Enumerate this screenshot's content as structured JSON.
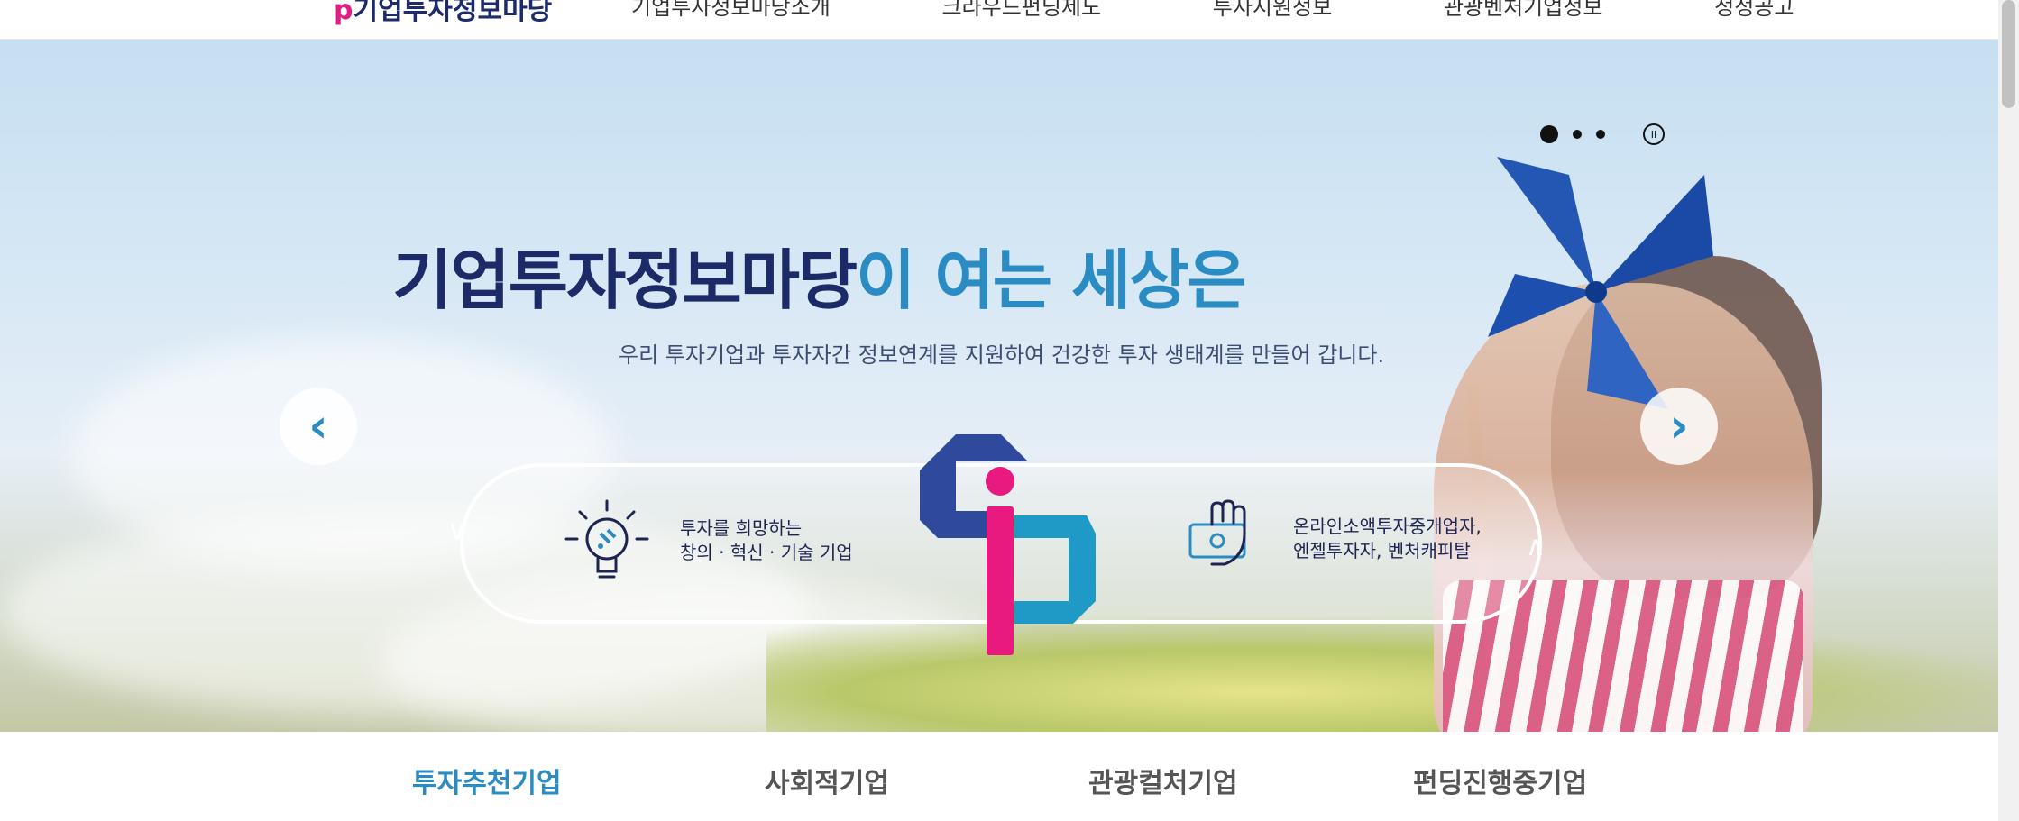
{
  "nav": {
    "logo": "기업투자정보마당",
    "items": [
      "기업투자정보마당소개",
      "크라우드펀딩제도",
      "투자지원정보",
      "관광벤처기업정보",
      "정정공고"
    ]
  },
  "hero": {
    "headline_main": "기업투자정보마당",
    "headline_accent": "이 여는 세상은",
    "subline": "우리 투자기업과 투자자간 정보연계를 지원하여 건강한 투자 생태계를 만들어 갑니다.",
    "features": [
      {
        "icon": "lightbulb-icon",
        "text": "투자를 희망하는\n창의 · 혁신 · 기술 기업"
      },
      {
        "icon": "hand-money-icon",
        "text": "온라인소액투자중개업자,\n엔젤투자자, 벤처캐피탈"
      }
    ],
    "carousel": {
      "slides": 3,
      "current": 1
    },
    "prev_arrow": "‹",
    "next_arrow": "›",
    "pause_glyph": "II"
  },
  "tabs": [
    {
      "label": "투자추천기업",
      "active": true
    },
    {
      "label": "사회적기업",
      "active": false
    },
    {
      "label": "관광컬처기업",
      "active": false
    },
    {
      "label": "펀딩진행중기업",
      "active": false
    }
  ],
  "colors": {
    "navy": "#1c2a68",
    "accent": "#2b8cc4",
    "pink": "#e01e83"
  }
}
